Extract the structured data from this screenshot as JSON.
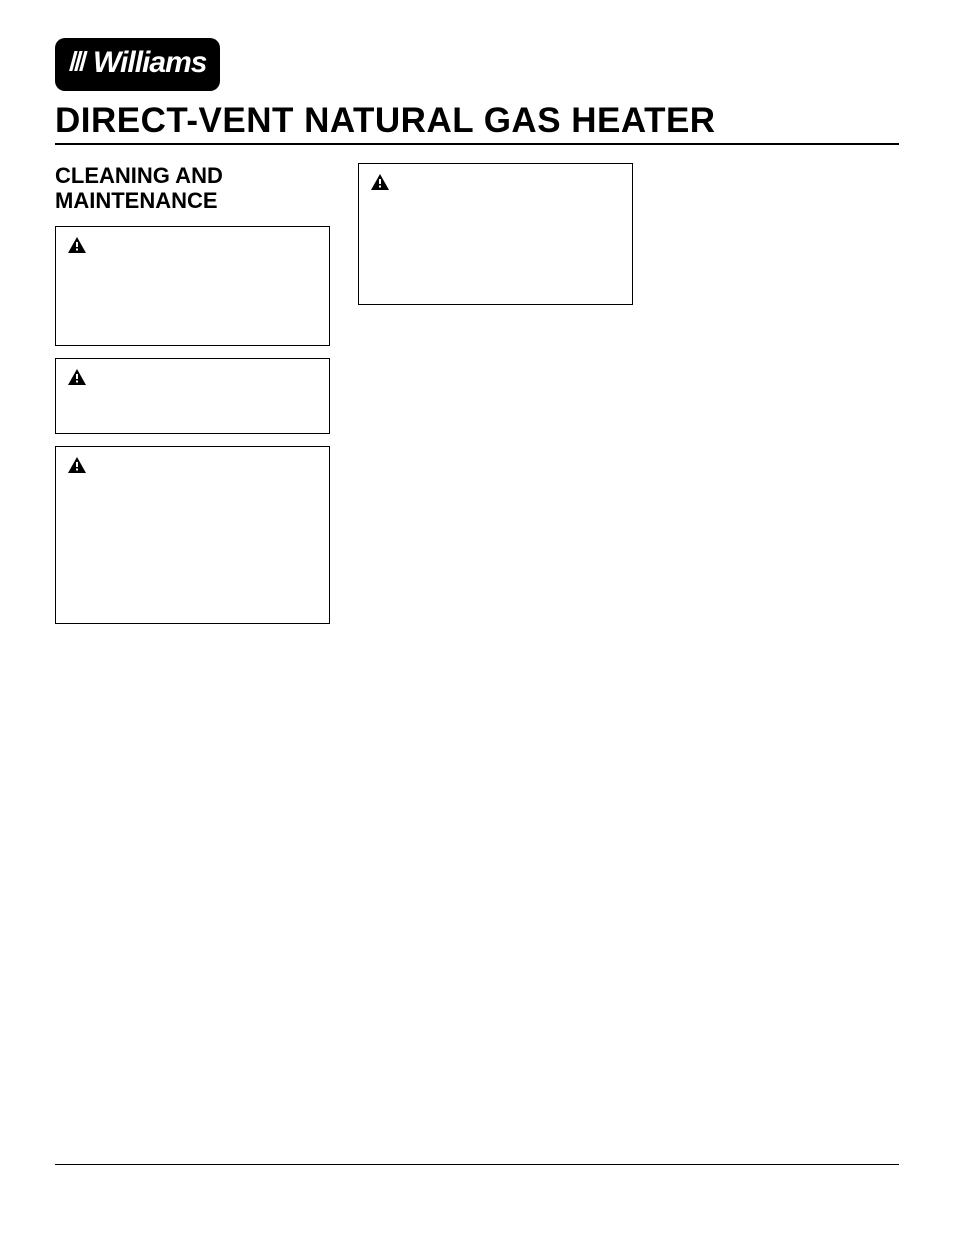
{
  "brand": {
    "name": "Williams"
  },
  "page_title": "DIRECT-VENT NATURAL GAS HEATER",
  "section": {
    "heading": "CLEANING AND MAINTENANCE"
  },
  "warning_boxes_col1": [
    {
      "label": ""
    },
    {
      "label": ""
    },
    {
      "label": ""
    }
  ],
  "warning_boxes_col2": [
    {
      "label": ""
    }
  ]
}
